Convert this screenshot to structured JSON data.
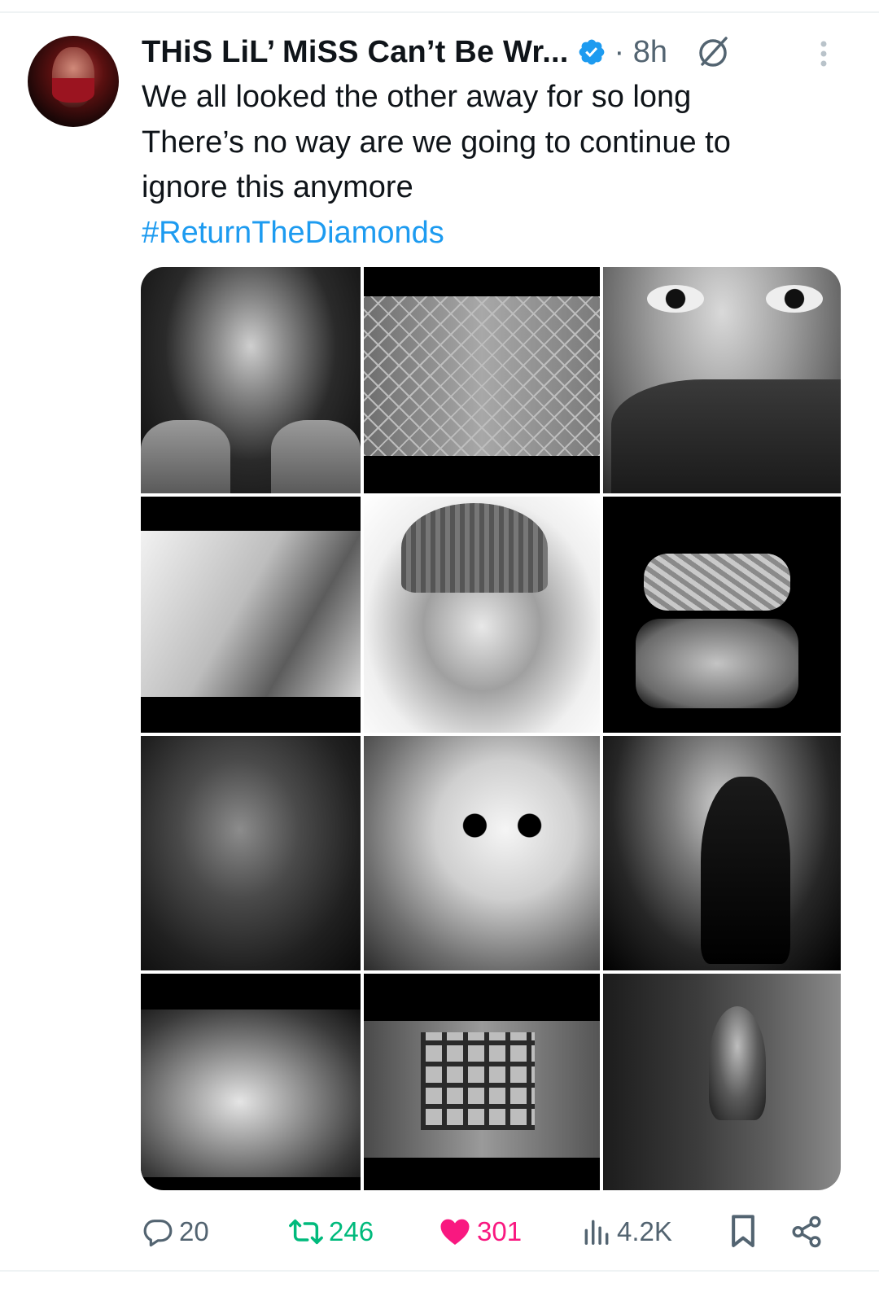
{
  "author": {
    "display_name": "THiS LiL’ MiSS Can’t Be Wr...",
    "time": "· 8h"
  },
  "tweet": {
    "lines": [
      "We all looked the other away for so long",
      "There’s no way are we going to continue to",
      "ignore this anymore"
    ],
    "hashtag": "#ReturnTheDiamonds"
  },
  "actions": {
    "replies": "20",
    "retweets": "246",
    "likes": "301",
    "views": "4.2K"
  },
  "colors": {
    "accent": "#1d9bf0",
    "retweet": "#00ba7c",
    "like": "#f91880",
    "muted": "#536471"
  },
  "icons": {
    "verified": "verified-badge-icon",
    "grok": "grok-icon",
    "more": "more-dots-icon",
    "reply": "reply-icon",
    "retweet": "retweet-icon",
    "like": "heart-icon",
    "views": "views-icon",
    "bookmark": "bookmark-icon",
    "share": "share-icon"
  }
}
